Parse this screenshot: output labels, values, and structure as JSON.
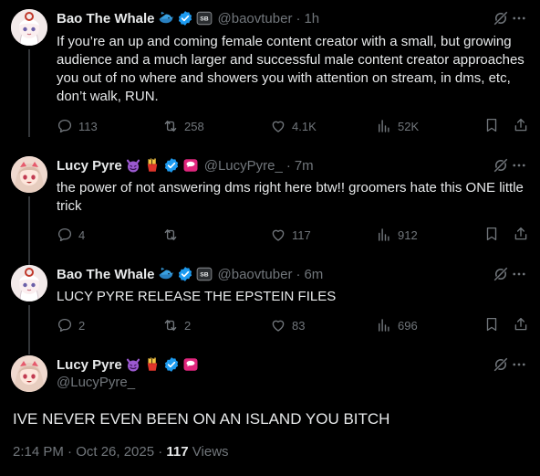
{
  "tweets": [
    {
      "author": "Bao The Whale",
      "handle": "@baovtuber",
      "time": "1h",
      "text": "If you’re an up and coming female content creator with a small, but growing audience and a much larger and successful male content creator approaches you out of no where and showers you with attention on stream, in dms, etc, don’t walk, RUN.",
      "replies": "113",
      "reposts": "258",
      "likes": "4.1K",
      "views": "52K"
    },
    {
      "author": "Lucy Pyre",
      "handle": "@LucyPyre_",
      "time": "7m",
      "text": "the power of not answering dms right here btw!! groomers hate this ONE little trick",
      "replies": "4",
      "reposts": "",
      "likes": "117",
      "views": "912"
    },
    {
      "author": "Bao The Whale",
      "handle": "@baovtuber",
      "time": "6m",
      "text": "LUCY PYRE RELEASE THE EPSTEIN FILES",
      "replies": "2",
      "reposts": "2",
      "likes": "83",
      "views": "696"
    }
  ],
  "main": {
    "author": "Lucy Pyre",
    "handle": "@LucyPyre_",
    "text": "IVE NEVER EVEN BEEN ON AN ISLAND YOU BITCH",
    "timestamp": "2:14 PM · Oct 26, 2025 · ",
    "views_count": "117",
    "views_label": " Views"
  },
  "icons": {
    "verified": "verified-badge-icon",
    "whale": "whale-emoji-icon",
    "devil": "smiling-devil-emoji-icon",
    "fries": "fries-emoji-icon",
    "grok": "grok-icon",
    "more": "more-icon",
    "reply": "reply-icon",
    "repost": "repost-icon",
    "like": "like-icon",
    "views": "views-icon",
    "bookmark": "bookmark-icon",
    "share": "share-icon"
  },
  "colors": {
    "background": "#000000",
    "text": "#e7e9ea",
    "muted": "#71767b",
    "verified": "#1d9bf0"
  }
}
